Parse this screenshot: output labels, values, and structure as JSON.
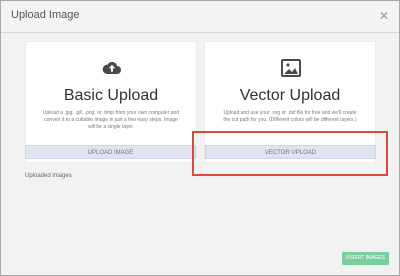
{
  "dialog": {
    "title": "Upload Image",
    "close_icon": "close-icon"
  },
  "cards": [
    {
      "heading": "Basic Upload",
      "description": "Upload a .jpg, .gif, .png, or .bmp from your own computer and convert it to a cuttable image in just a few easy steps. Image will be a single layer.",
      "button": "UPLOAD IMAGE",
      "icon": "cloud-upload-icon"
    },
    {
      "heading": "Vector Upload",
      "description": "Upload and use your .svg or .dxf file for free and we'll create the cut path for you. (Different colors will be different layers.)",
      "button": "VECTOR UPLOAD",
      "icon": "image-icon"
    }
  ],
  "uploaded_images_label": "Uploaded images",
  "insert_button": "INSERT IMAGES",
  "colors": {
    "accent_green": "#79d09e",
    "highlight_red": "#d84a3e",
    "button_blue": "#e0e4f2"
  }
}
